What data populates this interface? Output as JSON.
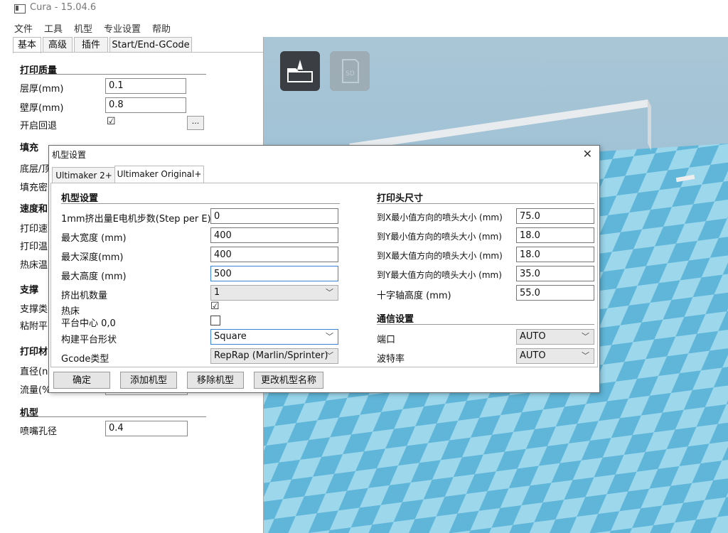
{
  "window": {
    "title": "Cura - 15.04.6"
  },
  "menu": [
    "文件",
    "工具",
    "机型",
    "专业设置",
    "帮助"
  ],
  "left_tabs": [
    "基本",
    "高级",
    "插件",
    "Start/End-GCode"
  ],
  "left": {
    "print_quality": {
      "title": "打印质量",
      "layer_height_label": "层厚(mm)",
      "layer_height": "0.1",
      "shell_label": "壁厚(mm)",
      "shell": "0.8",
      "retraction_label": "开启回退",
      "retraction_checked": "☑",
      "more": "..."
    },
    "fill": {
      "title": "填充",
      "bottom_top": "底层/顶",
      "density": "填充密"
    },
    "speed": {
      "title": "速度和",
      "print_speed": "打印速",
      "print_temp": "打印温",
      "bed_temp": "热床温"
    },
    "support": {
      "title": "支撑",
      "support_type": "支撑类",
      "platform_adhesion": "粘附平"
    },
    "filament": {
      "title": "打印材",
      "diameter": "直径(n",
      "flow": "流量(%"
    },
    "machine": {
      "title": "机型",
      "nozzle_label": "喷嘴孔径",
      "nozzle": "0.4"
    }
  },
  "dialog": {
    "title": "机型设置",
    "close": "✕",
    "tabs": [
      "Ultimaker 2+",
      "Ultimaker Original+"
    ],
    "machine_settings": {
      "title": "机型设置",
      "steps_label": "1mm挤出量E电机步数(Step per E)",
      "steps": "0",
      "width_label": "最大宽度 (mm)",
      "width": "400",
      "depth_label": "最大深度(mm)",
      "depth": "400",
      "height_label": "最大高度 (mm)",
      "height": "500",
      "extruders_label": "挤出机数量",
      "extruders": "1",
      "heated_bed_label": "热床",
      "heated_bed": "☑",
      "center_label": "平台中心 0,0",
      "center": "",
      "bed_shape_label": "构建平台形状",
      "bed_shape": "Square",
      "gcode_label": "Gcode类型",
      "gcode": "RepRap (Marlin/Sprinter)"
    },
    "head_size": {
      "title": "打印头尺寸",
      "x_min_label": "到X最小值方向的喷头大小 (mm)",
      "x_min": "75.0",
      "y_min_label": "到Y最小值方向的喷头大小 (mm)",
      "y_min": "18.0",
      "x_max_label": "到X最大值方向的喷头大小 (mm)",
      "x_max": "18.0",
      "y_max_label": "到Y最大值方向的喷头大小 (mm)",
      "y_max": "35.0",
      "gantry_label": "十字轴高度 (mm)",
      "gantry": "55.0"
    },
    "comm": {
      "title": "通信设置",
      "port_label": "端口",
      "port": "AUTO",
      "baud_label": "波特率",
      "baud": "AUTO"
    },
    "buttons": {
      "ok": "确定",
      "add": "添加机型",
      "remove": "移除机型",
      "rename": "更改机型名称"
    }
  }
}
